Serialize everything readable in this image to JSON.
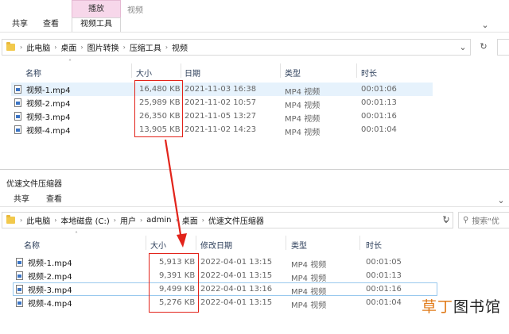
{
  "top_window": {
    "context_tab_header": "播放",
    "context_title": "视频",
    "tabs": [
      "共享",
      "查看",
      "视频工具"
    ],
    "breadcrumb": [
      "此电脑",
      "桌面",
      "图片转换",
      "压缩工具",
      "视频"
    ],
    "columns": [
      "名称",
      "大小",
      "日期",
      "类型",
      "时长"
    ],
    "files": [
      {
        "name": "视频-1.mp4",
        "size": "16,480 KB",
        "date": "2021-11-03 16:38",
        "type": "MP4 视频",
        "duration": "00:01:06"
      },
      {
        "name": "视频-2.mp4",
        "size": "25,989 KB",
        "date": "2021-11-02 10:57",
        "type": "MP4 视频",
        "duration": "00:01:13"
      },
      {
        "name": "视频-3.mp4",
        "size": "26,350 KB",
        "date": "2021-11-05 13:27",
        "type": "MP4 视频",
        "duration": "00:01:16"
      },
      {
        "name": "视频-4.mp4",
        "size": "13,905 KB",
        "date": "2021-11-02 14:23",
        "type": "MP4 视频",
        "duration": "00:01:04"
      }
    ]
  },
  "bottom_window": {
    "title": "优速文件压缩器",
    "tabs": [
      "共享",
      "查看"
    ],
    "breadcrumb": [
      "此电脑",
      "本地磁盘 (C:)",
      "用户",
      "admin",
      "桌面",
      "优速文件压缩器"
    ],
    "search_placeholder": "搜索\"优",
    "columns": [
      "名称",
      "大小",
      "修改日期",
      "类型",
      "时长"
    ],
    "files": [
      {
        "name": "视频-1.mp4",
        "size": "5,913 KB",
        "date": "2022-04-01 13:15",
        "type": "MP4 视频",
        "duration": "00:01:05"
      },
      {
        "name": "视频-2.mp4",
        "size": "9,391 KB",
        "date": "2022-04-01 13:15",
        "type": "MP4 视频",
        "duration": "00:01:13"
      },
      {
        "name": "视频-3.mp4",
        "size": "9,499 KB",
        "date": "2022-04-01 13:16",
        "type": "MP4 视频",
        "duration": "00:01:16"
      },
      {
        "name": "视频-4.mp4",
        "size": "5,276 KB",
        "date": "2022-04-01 13:15",
        "type": "MP4 视频",
        "duration": "00:01:04"
      }
    ]
  },
  "watermark": {
    "accent": "草丁",
    "rest": "图书馆"
  },
  "colors": {
    "annotation": "#e2231a",
    "context_tab": "#f7d7ea",
    "selection": "#e6f2fc"
  }
}
